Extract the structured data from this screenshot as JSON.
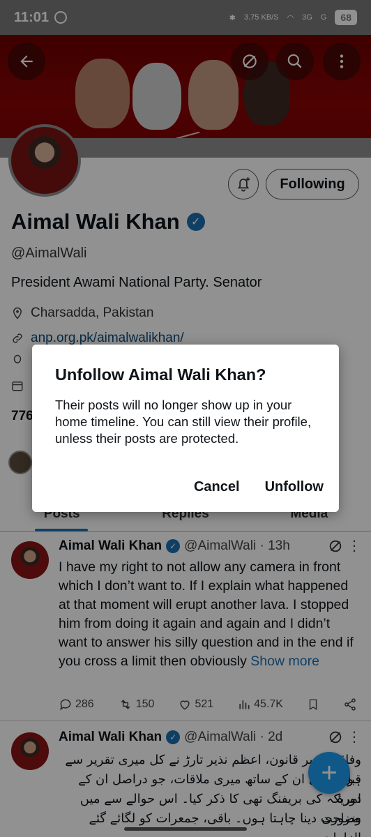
{
  "status_bar": {
    "time": "11:01",
    "net_speed": "3.75 KB/S",
    "network_1": "3G",
    "network_2": "G",
    "battery": "68"
  },
  "profile": {
    "name": "Aimal Wali Khan",
    "handle": "@AimalWali",
    "bio": "President Awami National Party. Senator",
    "location": "Charsadda, Pakistan",
    "link": "anp.org.pk/aimalwalikhan/",
    "following_button": "Following",
    "stats_partial": "776"
  },
  "tabs": [
    {
      "label": "Posts",
      "active": true
    },
    {
      "label": "Replies",
      "active": false
    },
    {
      "label": "Media",
      "active": false
    }
  ],
  "tweets": [
    {
      "name": "Aimal Wali Khan",
      "handle_time": "@AimalWali · 13h",
      "text": "I have my right to not allow any camera in front which I don’t want to. If I explain what happened at that moment will erupt another lava. I stopped him from doing it again and again and I didn’t want to answer his silly question and in the end if you cross a limit then obviously",
      "show_more": "Show more",
      "replies": "286",
      "reposts": "150",
      "likes": "521",
      "views": "45.7K"
    },
    {
      "name": "Aimal Wali Khan",
      "handle_time": "@AimalWali · 2d",
      "text_lines": [
        "وفاقی وزیر قانون، اعظم نذیر تارڑ نے کل میری تقریر سے قبل",
        "ہونے والی ان کے ساتھ میری ملاقات، جو دراصل ان کے دورۂ",
        "امریکہ کی بریفنگ تھی کا ذکر کیا۔ اس حوالے سے میں ضروری",
        "وضاحت دینا چاہتا ہوں۔ باقی، جمعرات کو لگائے گئے الزامات"
      ]
    }
  ],
  "dialog": {
    "title": "Unfollow Aimal Wali Khan?",
    "body": "Their posts will no longer show up in your home timeline. You can still view their profile, unless their posts are protected.",
    "cancel": "Cancel",
    "confirm": "Unfollow"
  },
  "fab_label": "+",
  "colors": {
    "accent": "#1d9bf0",
    "banner": "#8a0505",
    "overlay": "rgba(0,0,0,0.43)"
  }
}
